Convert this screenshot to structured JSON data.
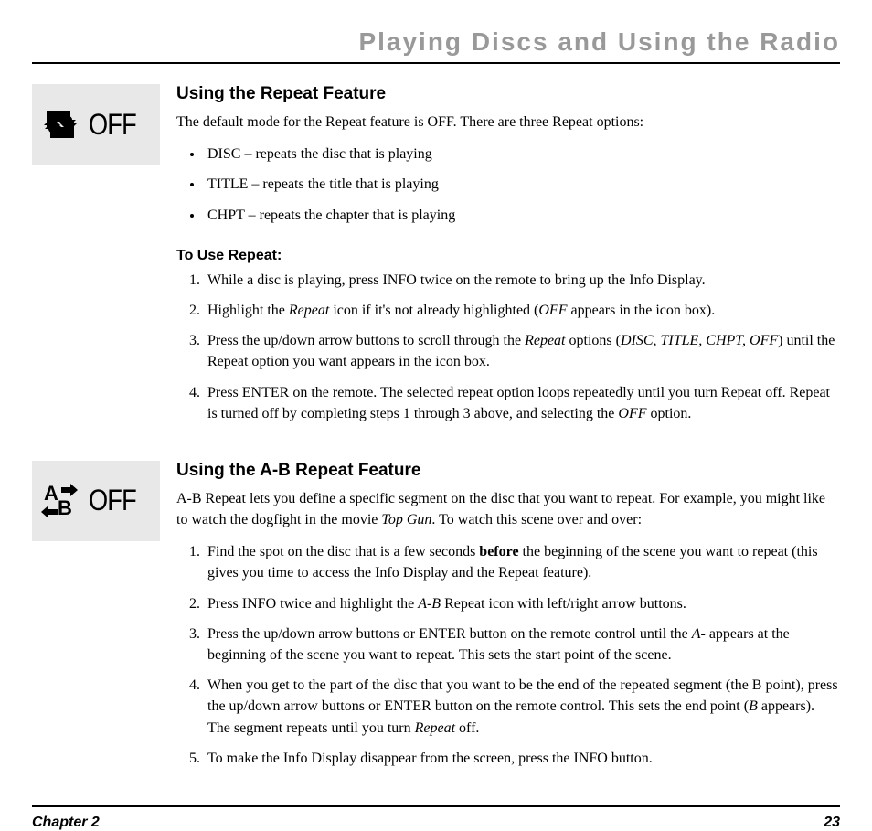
{
  "pageTitle": "Playing Discs and Using the Radio",
  "section1": {
    "iconLabel": "OFF",
    "heading": "Using the Repeat Feature",
    "intro": "The default mode for the Repeat feature is OFF. There are three Repeat options:",
    "bullets": [
      "DISC – repeats the disc that is playing",
      "TITLE – repeats the title that is playing",
      "CHPT – repeats the chapter that is playing"
    ],
    "subheading": "To Use Repeat:",
    "step1": "While a disc is playing, press INFO twice on the remote to bring up the Info Display.",
    "step2_a": "Highlight the ",
    "step2_b": "Repeat",
    "step2_c": " icon if it's not already highlighted (",
    "step2_d": "OFF",
    "step2_e": " appears in the icon box).",
    "step3_a": "Press the up/down arrow buttons to scroll through the ",
    "step3_b": "Repeat",
    "step3_c": " options (",
    "step3_d": "DISC, TITLE, CHPT, OFF",
    "step3_e": ") until the Repeat option you want appears in the icon box.",
    "step4_a": "Press ENTER on the remote. The selected repeat option loops repeatedly until you turn Repeat off. Repeat is turned off by completing steps 1 through 3 above, and selecting the ",
    "step4_b": "OFF",
    "step4_c": " option."
  },
  "section2": {
    "iconLabel": "OFF",
    "heading": "Using the A-B Repeat Feature",
    "intro_a": "A-B Repeat lets you define a specific segment on the disc that you want to repeat. For example, you might like to watch the dogfight in the movie ",
    "intro_b": "Top Gun",
    "intro_c": ". To watch this scene over and over:",
    "step1_a": "Find the spot on the disc that is a few seconds ",
    "step1_b": "before",
    "step1_c": " the beginning of the scene you want to repeat (this gives you time to access the Info Display and the Repeat feature).",
    "step2_a": "Press INFO twice and highlight the ",
    "step2_b": "A-B ",
    "step2_c": " Repeat icon with left/right arrow buttons.",
    "step3_a": "Press the up/down arrow buttons or ENTER button on the remote control until the ",
    "step3_b": "A-",
    "step3_c": " appears at the beginning of the scene you want to repeat. This sets the start point of the scene.",
    "step4_a": "When you get to the part of the disc that you want to be the end of the repeated segment (the B point), press the up/down arrow buttons or ENTER button on the remote control.  This sets the end point (",
    "step4_b": "B",
    "step4_c": " appears). The segment repeats until you turn ",
    "step4_d": "Repeat",
    "step4_e": " off.",
    "step5": "To make the Info Display disappear from the screen, press the INFO button."
  },
  "footer": {
    "chapter": "Chapter 2",
    "page": "23"
  }
}
